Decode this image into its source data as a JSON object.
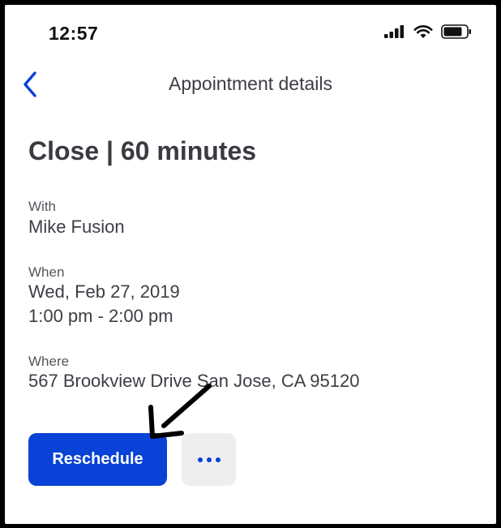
{
  "status_bar": {
    "time": "12:57"
  },
  "header": {
    "title": "Appointment details"
  },
  "appointment": {
    "title": "Close | 60 minutes",
    "with_label": "With",
    "with_value": "Mike Fusion",
    "when_label": "When",
    "when_date": "Wed, Feb 27, 2019",
    "when_time": "1:00 pm - 2:00 pm",
    "where_label": "Where",
    "where_value": "567 Brookview Drive San Jose, CA 95120"
  },
  "actions": {
    "reschedule_label": "Reschedule",
    "more_icon": "more-horizontal-icon"
  },
  "colors": {
    "accent": "#0842d6",
    "text_primary": "#3a3a42",
    "text_secondary": "#55555d",
    "more_button_bg": "#eeeef0"
  }
}
